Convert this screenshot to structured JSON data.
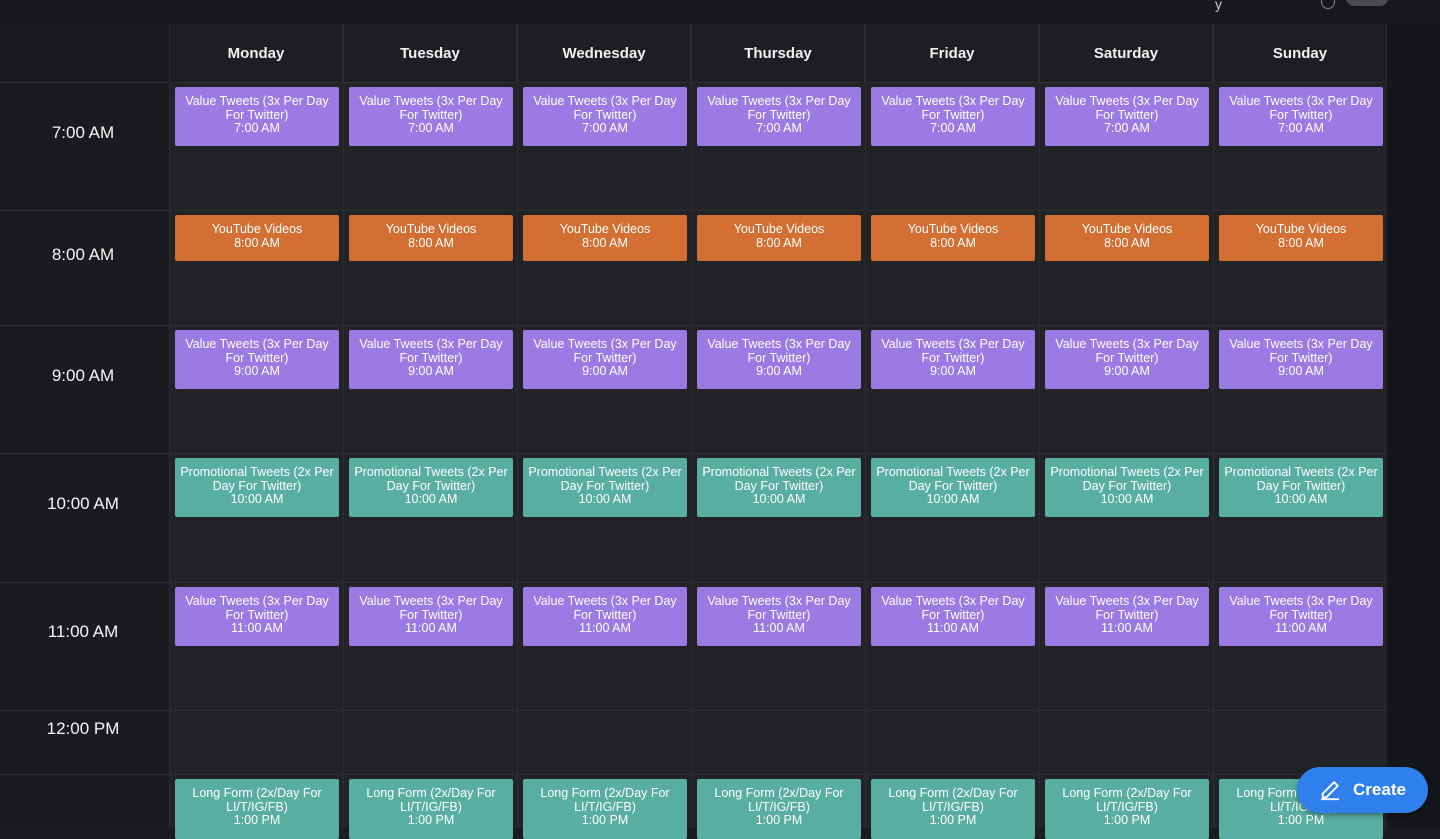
{
  "topbar": {
    "partial_text": "y",
    "help_icon": "help-circle-icon",
    "toggle_icon": "toggle-switch"
  },
  "days": [
    "Monday",
    "Tuesday",
    "Wednesday",
    "Thursday",
    "Friday",
    "Saturday",
    "Sunday"
  ],
  "times": [
    "7:00 AM",
    "8:00 AM",
    "9:00 AM",
    "10:00 AM",
    "11:00 AM",
    "12:00 PM"
  ],
  "event_colors": {
    "purple": "#9b7ae3",
    "orange": "#d36f33",
    "teal": "#58aea1"
  },
  "event_rows": [
    {
      "title": "Value Tweets (3x Per Day For Twitter)",
      "time": "7:00 AM",
      "color": "purple"
    },
    {
      "title": "YouTube Videos",
      "time": "8:00 AM",
      "color": "orange"
    },
    {
      "title": "Value Tweets (3x Per Day For Twitter)",
      "time": "9:00 AM",
      "color": "purple"
    },
    {
      "title": "Promotional Tweets (2x Per Day For Twitter)",
      "time": "10:00 AM",
      "color": "teal"
    },
    {
      "title": "Value Tweets (3x Per Day For Twitter)",
      "time": "11:00 AM",
      "color": "purple"
    },
    {
      "title": "Long Form (2x/Day For LI/T/IG/FB)",
      "time": "1:00 PM",
      "color": "teal"
    }
  ],
  "create_button": {
    "label": "Create",
    "icon": "pencil-icon"
  }
}
